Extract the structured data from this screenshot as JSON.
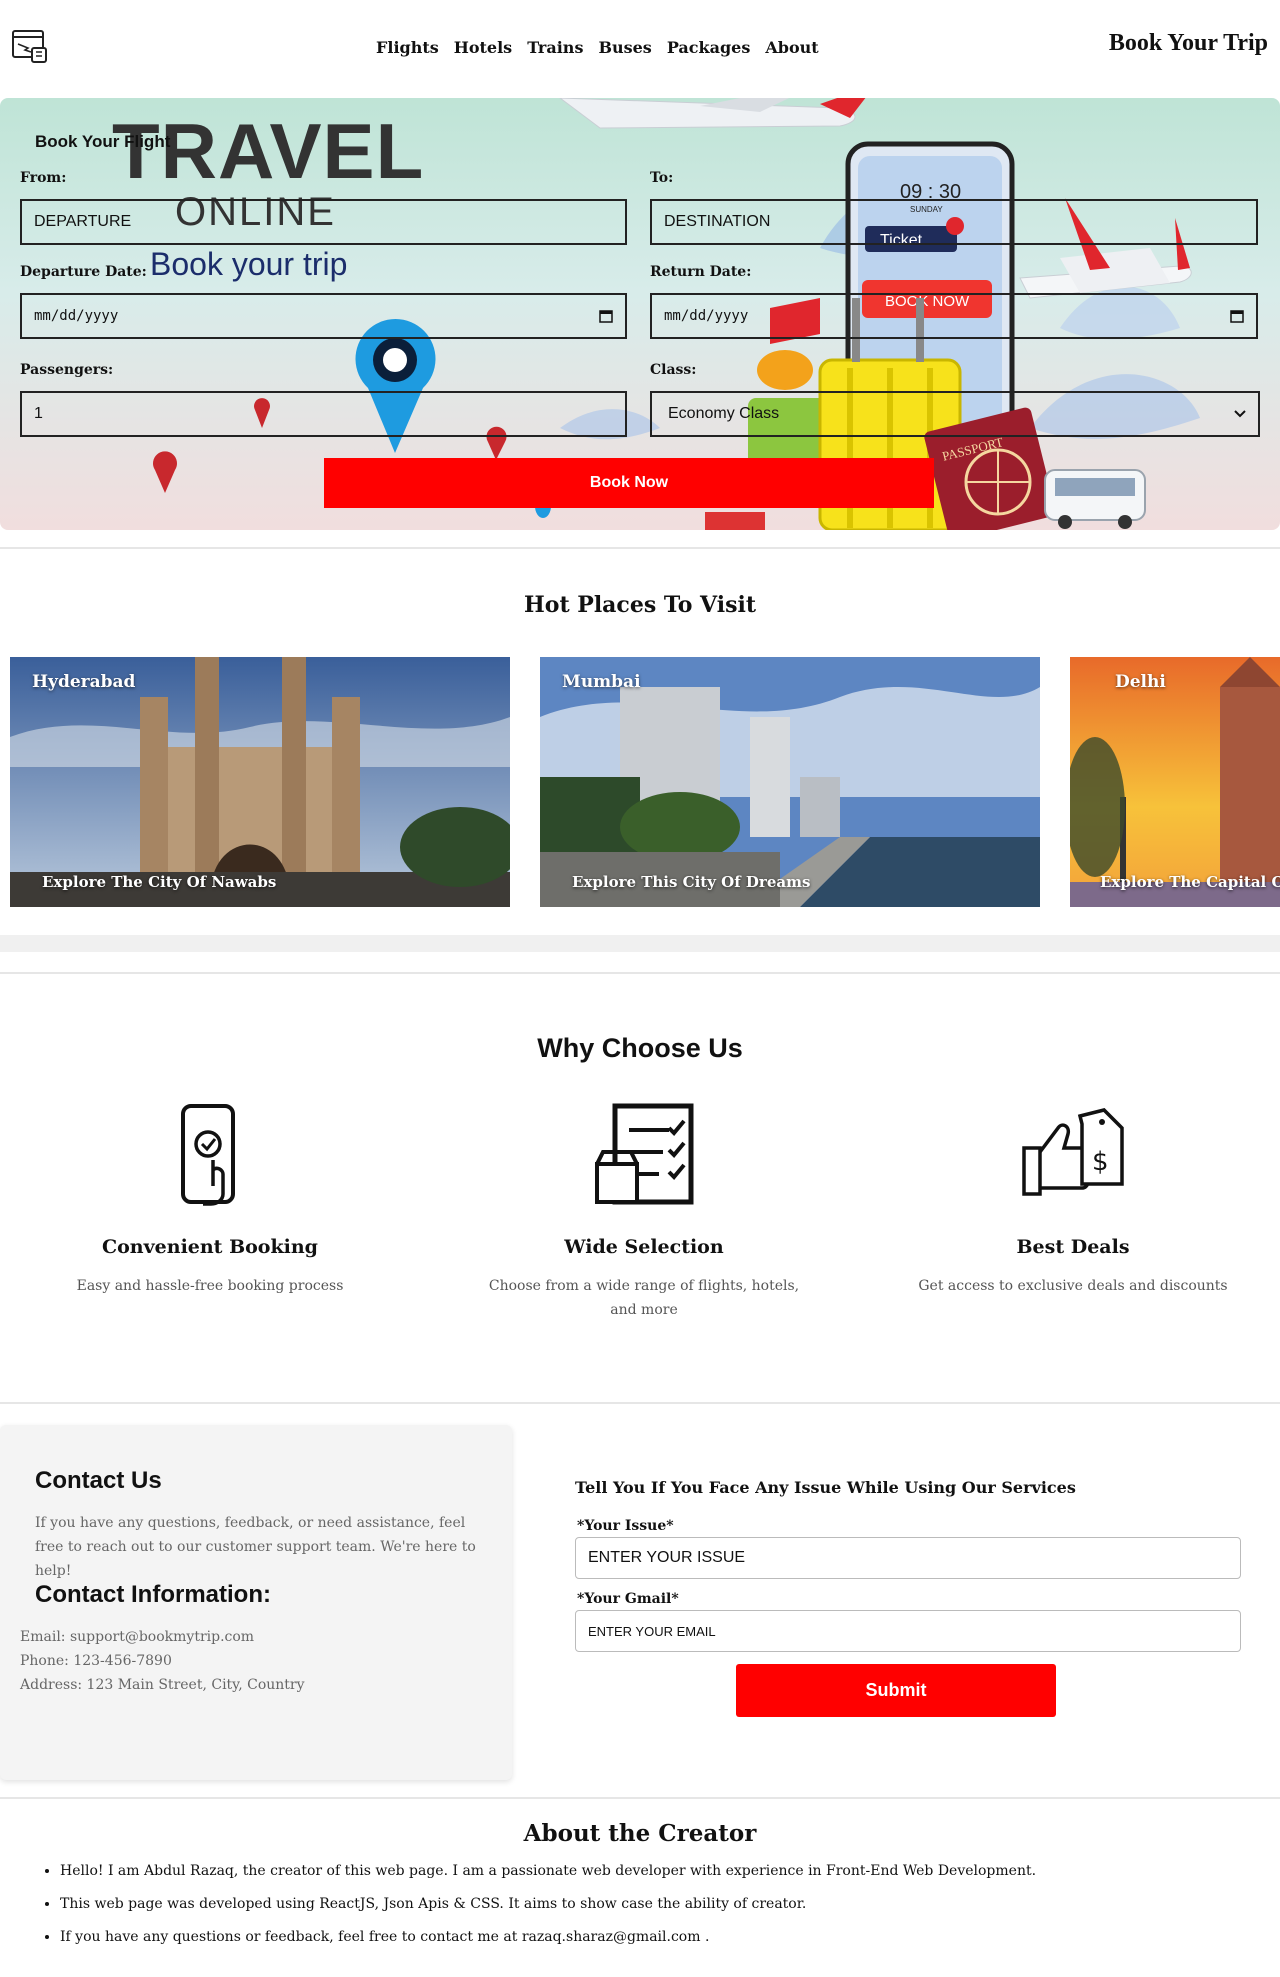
{
  "nav": {
    "links": [
      "Flights",
      "Hotels",
      "Trains",
      "Buses",
      "Packages",
      "About"
    ],
    "brand": "Book Your Trip"
  },
  "hero": {
    "title": "TRAVEL",
    "subtitle": "ONLINE",
    "tagline": "Book your trip",
    "form_title": "Book Your Flight",
    "from_label": "From:",
    "from_placeholder": "DEPARTURE",
    "to_label": "To:",
    "to_placeholder": "DESTINATION",
    "departure_label": "Departure Date:",
    "departure_value": "mm/dd/yyyy",
    "return_label": "Return Date:",
    "return_value": "mm/dd/yyyy",
    "passengers_label": "Passengers:",
    "passengers_value": "1",
    "class_label": "Class:",
    "class_value": "Economy Class",
    "book_button": "Book Now",
    "phone_time": "09 : 30",
    "phone_day": "SUNDAY",
    "phone_ticket": "Ticket",
    "phone_book": "BOOK NOW",
    "passport": "PASSPORT"
  },
  "hot_places": {
    "heading": "Hot Places To Visit",
    "items": [
      {
        "name": "Hyderabad",
        "tagline": "Explore The City Of Nawabs"
      },
      {
        "name": "Mumbai",
        "tagline": "Explore This City Of Dreams"
      },
      {
        "name": "Delhi",
        "tagline": "Explore The Capital Of I"
      }
    ]
  },
  "why": {
    "heading": "Why Choose Us",
    "features": [
      {
        "title": "Convenient Booking",
        "text": "Easy and hassle-free booking process",
        "icon": "phone-touch-icon"
      },
      {
        "title": "Wide Selection",
        "text": "Choose from a wide range of flights, hotels, and more",
        "icon": "checklist-store-icon"
      },
      {
        "title": "Best Deals",
        "text": "Get access to exclusive deals and discounts",
        "icon": "thumbs-up-tag-icon"
      }
    ]
  },
  "contact": {
    "heading": "Contact Us",
    "intro": "If you have any questions, feedback, or need assistance, feel free to reach out to our customer support team. We're here to help!",
    "info_heading": "Contact Information:",
    "email": "Email: support@bookmytrip.com",
    "phone": "Phone: 123-456-7890",
    "address": "Address: 123 Main Street, City, Country",
    "form_title": "Tell You If You Face Any Issue While Using Our Services",
    "issue_label": "*Your Issue*",
    "issue_placeholder": "ENTER YOUR ISSUE",
    "gmail_label": "*Your Gmail*",
    "gmail_placeholder": "ENTER YOUR EMAIL",
    "submit": "Submit"
  },
  "about": {
    "heading": "About the Creator",
    "items": [
      "Hello! I am Abdul Razaq, the creator of this web page. I am a passionate web developer with experience in Front-End Web Development.",
      "This web page was developed using ReactJS, Json Apis & CSS. It aims to show case the ability of creator.",
      "If you have any questions or feedback, feel free to contact me at razaq.sharaz@gmail.com ."
    ]
  },
  "colors": {
    "accent": "#ff0000",
    "text": "#111111",
    "muted": "#666666"
  }
}
